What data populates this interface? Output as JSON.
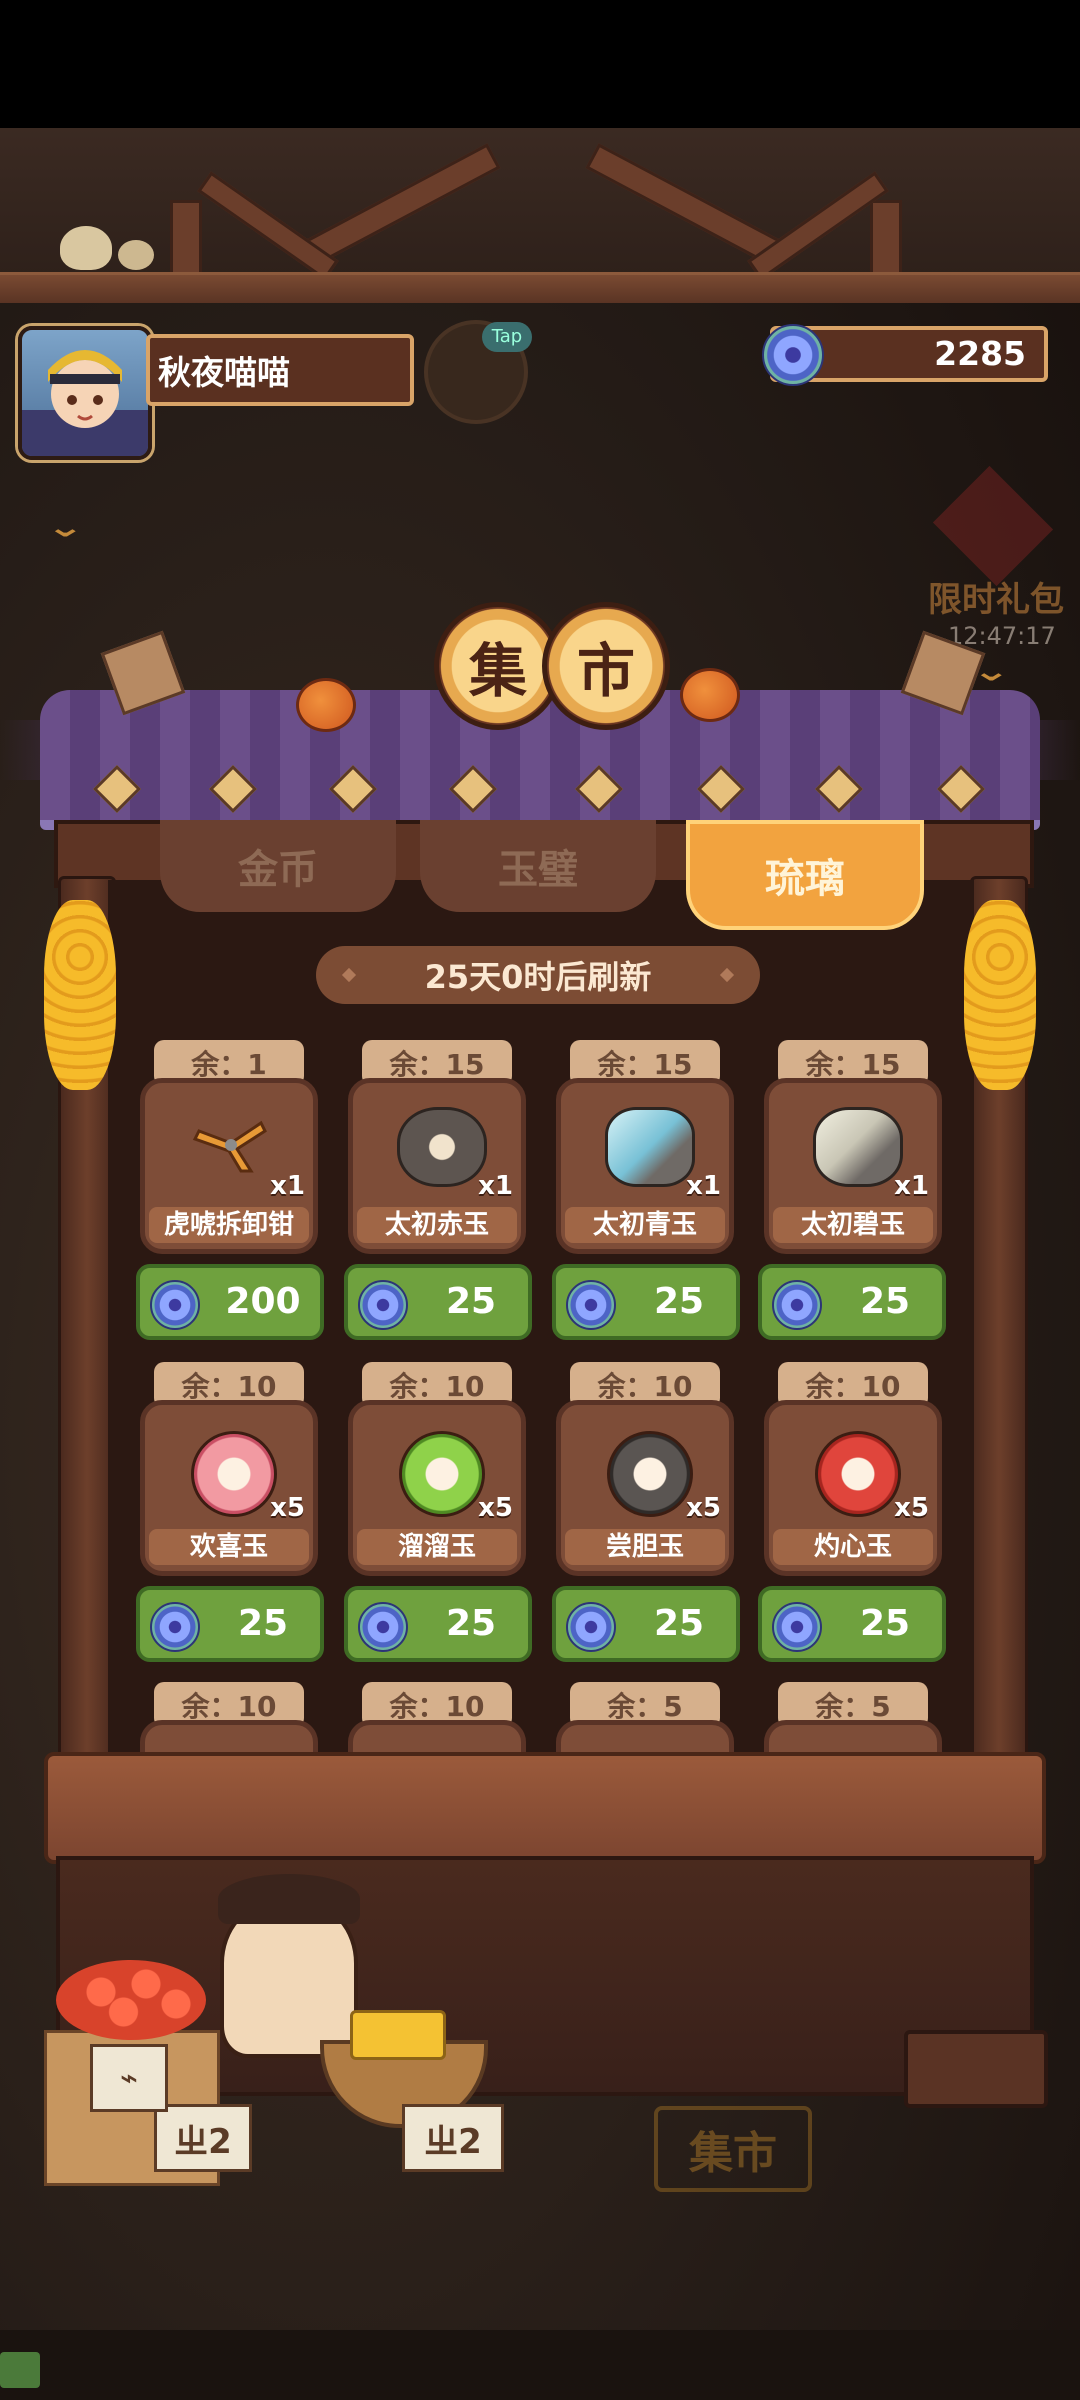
{
  "player": {
    "name": "秋夜喵喵",
    "tap_label": "Tap"
  },
  "currency": {
    "icon": "jade-coin-icon",
    "value": "2285"
  },
  "side_offer": {
    "label": "限时礼包",
    "timer": "12:47:17"
  },
  "shop_sign": {
    "char1": "集",
    "char2": "市"
  },
  "tabs": [
    {
      "label": "金币",
      "active": false
    },
    {
      "label": "玉璧",
      "active": false
    },
    {
      "label": "琉璃",
      "active": true
    }
  ],
  "refresh_text": "25天0时后刷新",
  "items": [
    {
      "stock": "余：1",
      "name": "虎唬拆卸钳",
      "qty": "x1",
      "price": "200",
      "icon": "pliers-icon"
    },
    {
      "stock": "余：15",
      "name": "太初赤玉",
      "qty": "x1",
      "price": "25",
      "icon": "red-ore-icon"
    },
    {
      "stock": "余：15",
      "name": "太初青玉",
      "qty": "x1",
      "price": "25",
      "icon": "blue-ore-icon"
    },
    {
      "stock": "余：15",
      "name": "太初碧玉",
      "qty": "x1",
      "price": "25",
      "icon": "green-ore-icon"
    },
    {
      "stock": "余：10",
      "name": "欢喜玉",
      "qty": "x5",
      "price": "25",
      "icon": "pink-jade-icon"
    },
    {
      "stock": "余：10",
      "name": "溜溜玉",
      "qty": "x5",
      "price": "25",
      "icon": "green-jade-icon"
    },
    {
      "stock": "余：10",
      "name": "尝胆玉",
      "qty": "x5",
      "price": "25",
      "icon": "black-jade-icon"
    },
    {
      "stock": "余：10",
      "name": "灼心玉",
      "qty": "x5",
      "price": "25",
      "icon": "red-jade-icon"
    }
  ],
  "partial_row": [
    "余：10",
    "余：10",
    "余：5",
    "余：5"
  ],
  "counter_tags": [
    "ㄓ2",
    "ㄓ2"
  ],
  "bottom_sign": "集市",
  "colors": {
    "price_green": "#6fa13e",
    "tab_active": "#f2a33f",
    "roof_purple": "#6b4f8a"
  }
}
